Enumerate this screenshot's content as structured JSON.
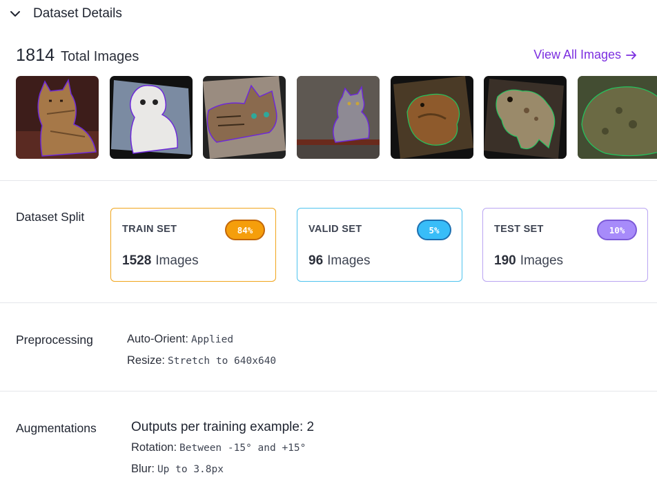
{
  "header": {
    "title": "Dataset Details",
    "toggle_icon": "chevron-down-icon"
  },
  "summary": {
    "total_count": "1814",
    "total_label": "Total Images",
    "view_all_label": "View All Images",
    "view_all_icon": "arrow-right-icon"
  },
  "thumbnails": [
    {
      "subject": "cat"
    },
    {
      "subject": "cat"
    },
    {
      "subject": "cat"
    },
    {
      "subject": "cat"
    },
    {
      "subject": "toad"
    },
    {
      "subject": "toad"
    },
    {
      "subject": "toad"
    }
  ],
  "split": {
    "label": "Dataset Split",
    "cards": [
      {
        "name": "TRAIN SET",
        "percent": "84%",
        "count": "1528",
        "unit": "Images",
        "color": "#f59e0b"
      },
      {
        "name": "VALID SET",
        "percent": "5%",
        "count": "96",
        "unit": "Images",
        "color": "#38bdf8"
      },
      {
        "name": "TEST SET",
        "percent": "10%",
        "count": "190",
        "unit": "Images",
        "color": "#a78bfa"
      }
    ]
  },
  "preprocessing": {
    "label": "Preprocessing",
    "items": [
      {
        "key": "Auto-Orient:",
        "value": "Applied"
      },
      {
        "key": "Resize:",
        "value": "Stretch to 640x640"
      }
    ]
  },
  "augmentations": {
    "label": "Augmentations",
    "outputs": "Outputs per training example: 2",
    "items": [
      {
        "key": "Rotation:",
        "value": "Between -15° and +15°"
      },
      {
        "key": "Blur:",
        "value": "Up to 3.8px"
      }
    ]
  },
  "colors": {
    "accent": "#7c2fe0",
    "cat_outline": "#6d28d9",
    "toad_outline": "#22c55e"
  }
}
